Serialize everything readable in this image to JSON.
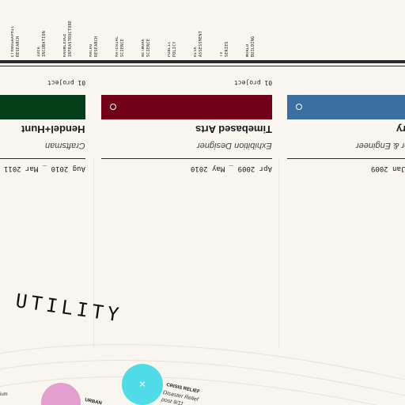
{
  "categories": [
    "ETHNOGRAPHIC\nRESEARCH",
    "IDEA\nINCUBATION",
    "KNOWLEDGE\nINFRASTRUCTURE",
    "MACRO\nRESEARCH",
    "MATERIAL\nSCIENCE",
    "NETWORK\nSCIENCE",
    "PUBLIC\nPOLICY",
    "RISK\nASSESSMENT",
    "TV\nSERIES",
    "WORLD\nBUILDING"
  ],
  "jobs": [
    {
      "projects": "01 project",
      "company": "Hendel+Hunt",
      "role": "Craftsman",
      "dates": "Aug 2010 _ Mar 2011",
      "color": "#033f1a"
    },
    {
      "projects": "01 project",
      "company": "Timebased Arts",
      "role": "Exhibition Designer",
      "dates": "Apr 2009 _ May 2010",
      "color": "#730019"
    },
    {
      "projects": "01 project",
      "company": "Scenery",
      "role": "Designer & Engineer",
      "dates": "Jan 2009",
      "color": "#3b6fa4"
    }
  ],
  "section_title": "UTILITY",
  "bubbles": [
    {
      "title": "CRISIS RELIEF",
      "desc_lines": [
        "Disaster Relief",
        "post 9/11"
      ],
      "color": "#4fdbe8",
      "icon": "cross-icon"
    },
    {
      "title": "URBAN",
      "desc_lines": [],
      "color": "#e39fd0",
      "icon": "circle-icon"
    }
  ],
  "edge_label": "ium"
}
